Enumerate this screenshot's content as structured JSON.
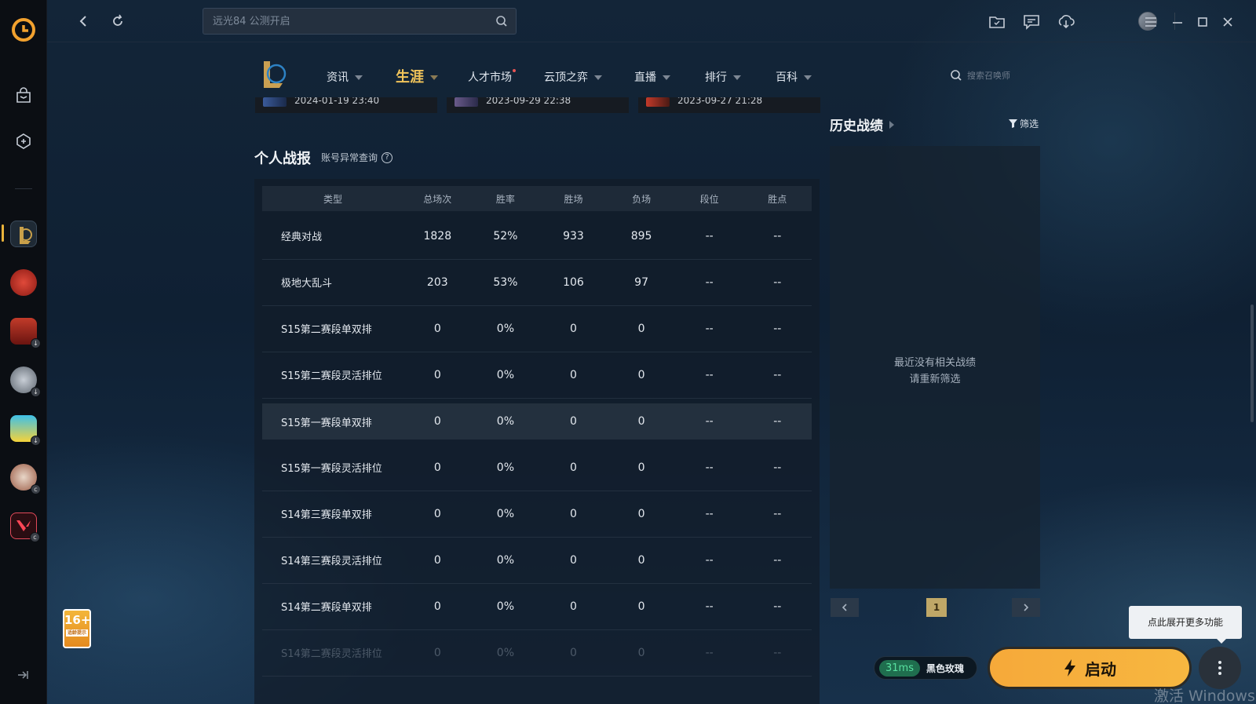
{
  "search": {
    "placeholder": "远光84 公测开启"
  },
  "game_nav": {
    "items": [
      {
        "label": "资讯"
      },
      {
        "label": "生涯"
      },
      {
        "label": "人才市场"
      },
      {
        "label": "云顶之弈"
      },
      {
        "label": "直播"
      },
      {
        "label": "排行"
      },
      {
        "label": "百科"
      }
    ],
    "summoner_search": "搜索召唤师"
  },
  "cards": [
    {
      "time": "2024-01-19 23:40"
    },
    {
      "time": "2023-09-29 22:38"
    },
    {
      "time": "2023-09-27 21:28"
    }
  ],
  "personal_stats": {
    "title": "个人战报",
    "account_link": "账号异常查询",
    "help_glyph": "?",
    "columns": [
      "类型",
      "总场次",
      "胜率",
      "胜场",
      "负场",
      "段位",
      "胜点"
    ],
    "rows": [
      [
        "经典对战",
        "1828",
        "52%",
        "933",
        "895",
        "--",
        "--"
      ],
      [
        "极地大乱斗",
        "203",
        "53%",
        "106",
        "97",
        "--",
        "--"
      ],
      [
        "S15第二赛段单双排",
        "0",
        "0%",
        "0",
        "0",
        "--",
        "--"
      ],
      [
        "S15第二赛段灵活排位",
        "0",
        "0%",
        "0",
        "0",
        "--",
        "--"
      ],
      [
        "S15第一赛段单双排",
        "0",
        "0%",
        "0",
        "0",
        "--",
        "--"
      ],
      [
        "S15第一赛段灵活排位",
        "0",
        "0%",
        "0",
        "0",
        "--",
        "--"
      ],
      [
        "S14第三赛段单双排",
        "0",
        "0%",
        "0",
        "0",
        "--",
        "--"
      ],
      [
        "S14第三赛段灵活排位",
        "0",
        "0%",
        "0",
        "0",
        "--",
        "--"
      ],
      [
        "S14第二赛段单双排",
        "0",
        "0%",
        "0",
        "0",
        "--",
        "--"
      ],
      [
        "S14第二赛段灵活排位",
        "0",
        "0%",
        "0",
        "0",
        "--",
        "--"
      ]
    ]
  },
  "history": {
    "title": "历史战绩",
    "filter": "筛选",
    "empty_line1": "最近没有相关战绩",
    "empty_line2": "请重新筛选",
    "page": "1"
  },
  "age_rating": {
    "label": "16+",
    "sub": "适龄提示"
  },
  "launch": {
    "tooltip": "点此展开更多功能",
    "ping": "31ms",
    "server": "黑色玫瑰",
    "button": "启动"
  },
  "watermark": "激活 Windows",
  "colors": {
    "accent": "#f1c45a",
    "launch": "#f7b740",
    "ping": "#58e0a0"
  }
}
